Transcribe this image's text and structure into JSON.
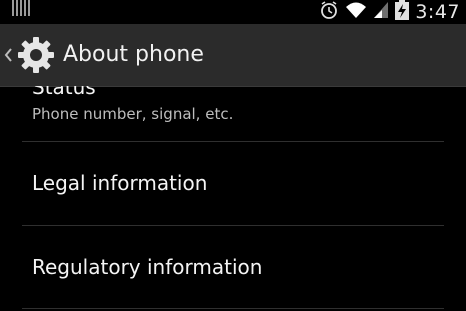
{
  "status_bar": {
    "time": "3:47",
    "icons": [
      "notification-icon",
      "alarm-icon",
      "wifi-icon",
      "signal-icon",
      "battery-charging-icon"
    ]
  },
  "action_bar": {
    "title": "About phone",
    "icon": "gear-icon",
    "up_icon": "chevron-left-icon"
  },
  "list": {
    "items": [
      {
        "title": "Status",
        "summary": "Phone number, signal, etc."
      },
      {
        "title": "Legal information"
      },
      {
        "title": "Regulatory information"
      }
    ]
  },
  "colors": {
    "background": "#000000",
    "action_bar": "#2b2b2b",
    "divider": "#2f2f2f",
    "text_primary": "#f4f4f4",
    "text_secondary": "#bdbdbd"
  }
}
